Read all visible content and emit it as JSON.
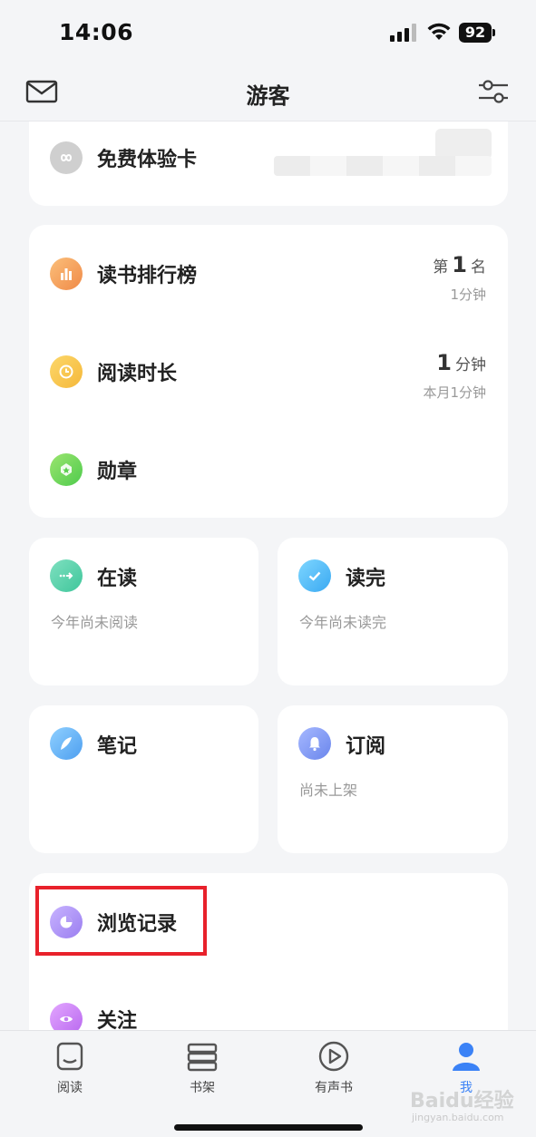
{
  "status_bar": {
    "time": "14:06",
    "battery": "92"
  },
  "nav": {
    "title": "游客",
    "mail_icon": "mail-icon",
    "settings_icon": "sliders-icon"
  },
  "free_card": {
    "label": "免费体验卡",
    "icon": "infinity-icon"
  },
  "stats": {
    "ranking": {
      "label": "读书排行榜",
      "prefix": "第",
      "rank": "1",
      "suffix": "名",
      "sub": "1分钟",
      "icon": "bar-chart-icon"
    },
    "reading_time": {
      "label": "阅读时长",
      "value": "1",
      "unit": "分钟",
      "sub": "本月1分钟",
      "icon": "clock-icon"
    },
    "medals": {
      "label": "勋章",
      "icon": "medal-icon"
    }
  },
  "tiles": {
    "reading": {
      "label": "在读",
      "sub": "今年尚未阅读",
      "icon": "arrow-right-icon"
    },
    "finished": {
      "label": "读完",
      "sub": "今年尚未读完",
      "icon": "check-icon"
    },
    "notes": {
      "label": "笔记",
      "icon": "quill-icon"
    },
    "subscribe": {
      "label": "订阅",
      "sub": "尚未上架",
      "icon": "bell-icon"
    }
  },
  "list": {
    "history": {
      "label": "浏览记录",
      "icon": "pie-icon"
    },
    "follow": {
      "label": "关注",
      "icon": "eye-icon"
    }
  },
  "tab_bar": [
    {
      "label": "阅读",
      "icon": "book-icon"
    },
    {
      "label": "书架",
      "icon": "bookshelf-icon"
    },
    {
      "label": "有声书",
      "icon": "play-icon"
    },
    {
      "label": "我",
      "icon": "user-icon"
    }
  ],
  "watermark": {
    "brand": "Baidu经验",
    "url": "jingyan.baidu.com"
  },
  "colors": {
    "accent": "#3b82f6",
    "highlight": "#e8212b"
  }
}
